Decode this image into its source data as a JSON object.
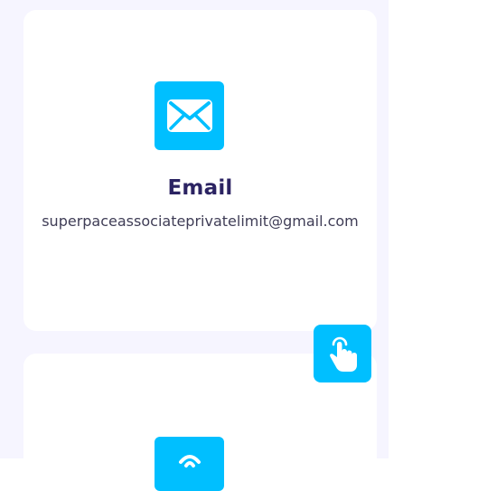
{
  "contact": {
    "email_card": {
      "title": "Email",
      "value": "superpaceassociateprivatelimit@gmail.com",
      "icon": "envelope-icon"
    },
    "phone_card": {
      "icon": "phone-icon"
    }
  },
  "floating_button": {
    "icon": "hand-pointer-icon"
  },
  "colors": {
    "accent": "#00bfff",
    "title": "#2b2362",
    "text": "#3f3d56",
    "panel_background": "#f6f5ff",
    "card_background": "#ffffff"
  }
}
